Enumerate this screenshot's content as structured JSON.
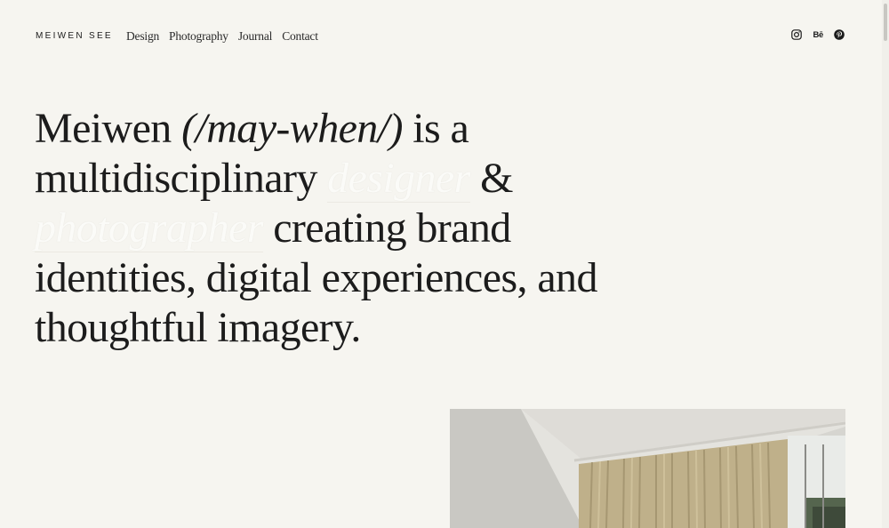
{
  "header": {
    "brand": "MEIWEN SEE",
    "nav": [
      "Design",
      "Photography",
      "Journal",
      "Contact"
    ],
    "social": [
      {
        "icon": "instagram-icon"
      },
      {
        "icon": "behance-icon",
        "label": "Bē"
      },
      {
        "icon": "pinterest-icon"
      }
    ]
  },
  "hero": {
    "name": "Meiwen",
    "pronunciation": "(/may-when/)",
    "is_a": "is a",
    "multidisciplinary": "multidisciplinary",
    "designer": "designer",
    "amp": "&",
    "photographer": "photographer",
    "creating_brand": "creating brand",
    "line4": "identities, digital experiences, and",
    "line5": "thoughtful imagery."
  },
  "colors": {
    "background": "#f6f5f0",
    "text": "#1c1c1c",
    "ghost_text": "#fbfbf8"
  },
  "photo": {
    "subject": "room-with-curtains-photo"
  }
}
